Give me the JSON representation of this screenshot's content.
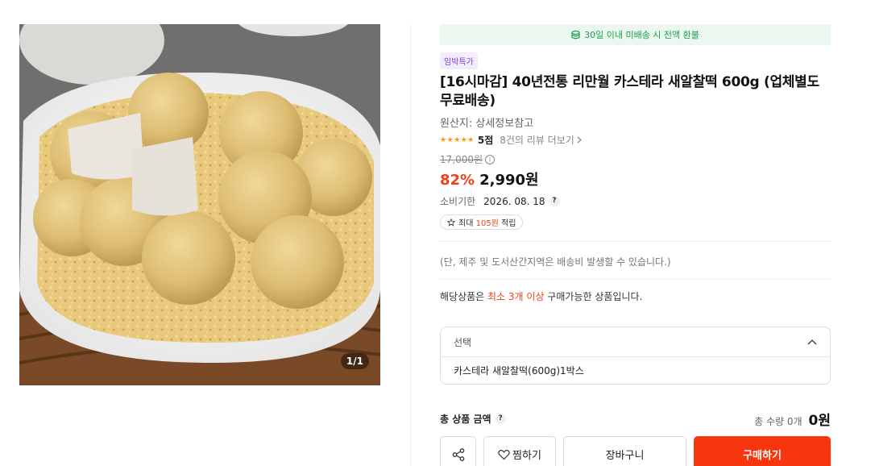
{
  "image": {
    "counter": "1/1"
  },
  "banner": {
    "icon": "coin-stack-icon",
    "text": "30일 이내 미배송 시 전액 환불"
  },
  "product": {
    "tag": "임박특가",
    "title": "[16시마감] 40년전통 리만월 카스테라 새알찰떡 600g (업체별도무료배송)",
    "origin": "원산지: 상세정보참고",
    "rating_stars": "★★★★★",
    "rating_score": "5점",
    "review_link": "8건의 리뷰 더보기",
    "original_price": "17,000원",
    "discount": "82%",
    "price": "2,990원",
    "expiry_label": "소비기한",
    "expiry_date": "2026. 08. 18",
    "points": {
      "prefix": "최대 ",
      "amount": "105원",
      "suffix": " 적립"
    },
    "shipping_note": "(단, 제주 및 도서산간지역은 배송비 발생할 수 있습니다.)",
    "min_note": {
      "prefix": "해당상품은 ",
      "highlight": "최소 3개 이상",
      "suffix": " 구매가능한 상품입니다."
    }
  },
  "option": {
    "header": "선택",
    "item": "카스테라 새알찰떡(600g)1박스"
  },
  "total": {
    "label": "총 상품 금액",
    "quantity": "총 수량 0개",
    "amount": "0원"
  },
  "buttons": {
    "like": "찜하기",
    "cart": "장바구니",
    "buy": "구매하기"
  },
  "colors": {
    "accent": "#f7360f",
    "discount": "#f2401d",
    "banner_bg": "#eaf8ef",
    "banner_text": "#1e9c4d",
    "tag_bg": "#f3ecff",
    "tag_text": "#7b3fe4",
    "star": "#ff9500"
  }
}
